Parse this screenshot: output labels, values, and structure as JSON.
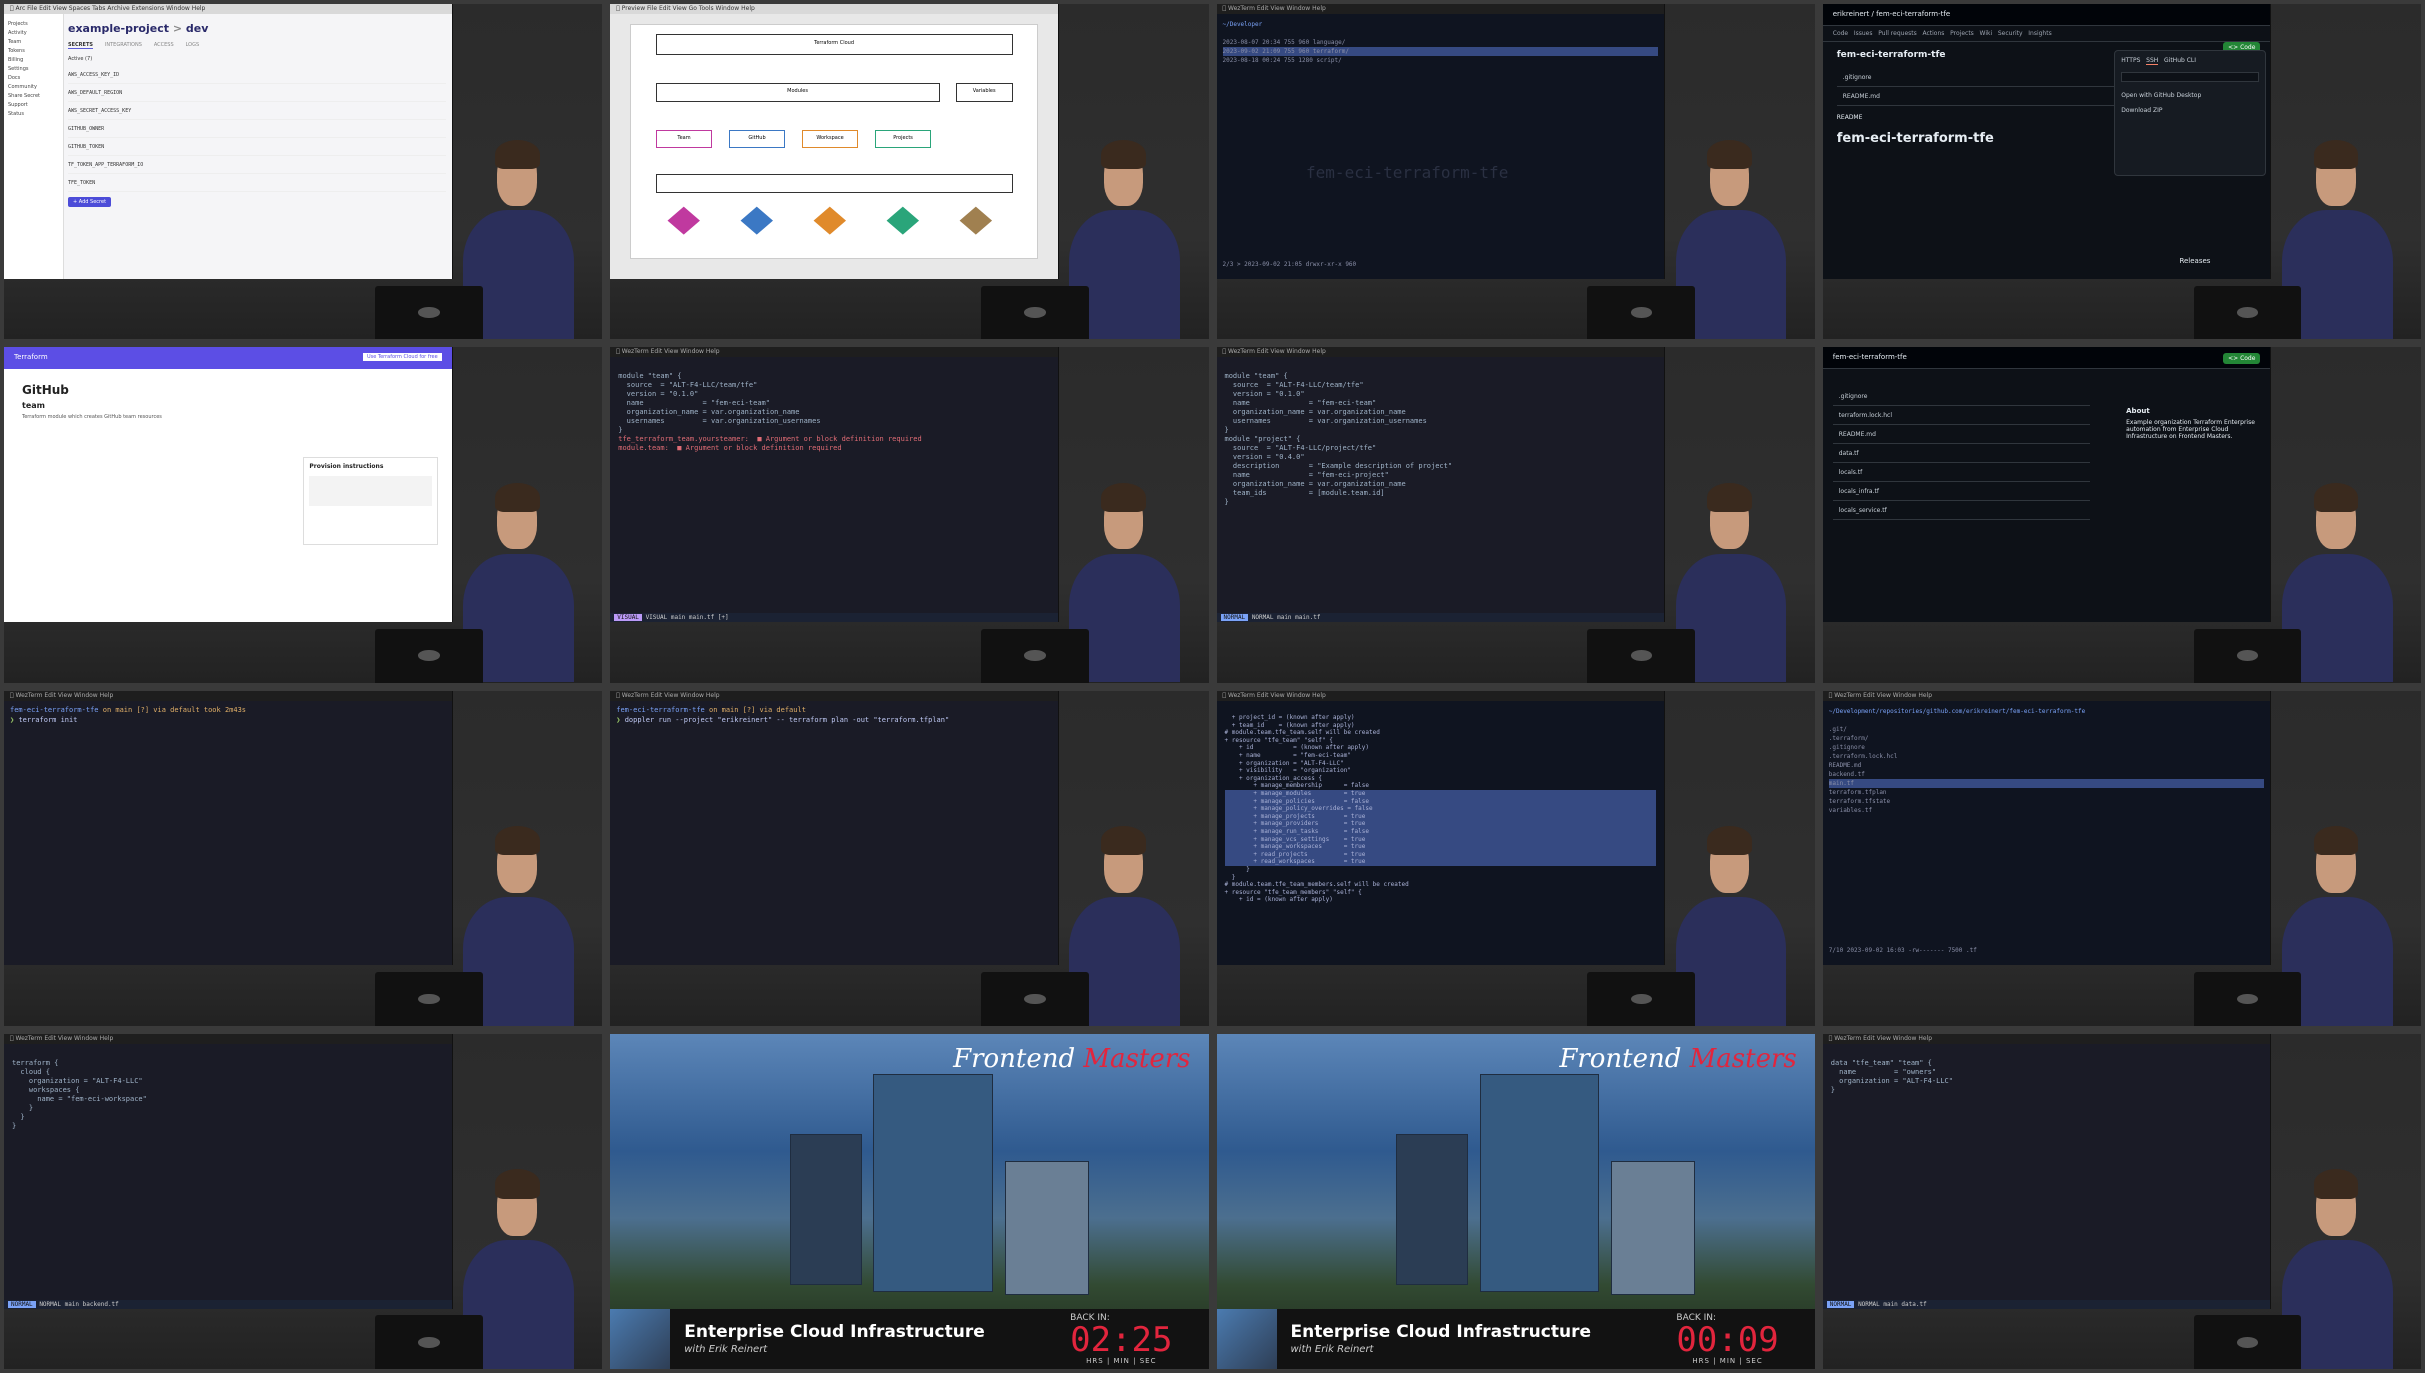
{
  "tiles": {
    "t1": {
      "project": "example-project",
      "env": "dev",
      "tabs": [
        "SECRETS",
        "INTEGRATIONS",
        "ACCESS",
        "LOGS"
      ],
      "active_label": "Active (7)",
      "secrets": [
        "AWS_ACCESS_KEY_ID",
        "AWS_DEFAULT_REGION",
        "AWS_SECRET_ACCESS_KEY",
        "GITHUB_OWNER",
        "GITHUB_TOKEN",
        "TF_TOKEN_APP_TERRAFORM_IO",
        "TFE_TOKEN"
      ],
      "add_secret": "+ Add Secret",
      "sidebar": [
        "Projects",
        "Activity",
        "Team",
        "Tokens",
        "Billing",
        "Settings",
        "Docs",
        "Community",
        "Share Secret",
        "Support",
        "Status"
      ]
    },
    "t2": {
      "nodes": [
        "Terraform Cloud",
        "Modules",
        "Variables",
        "Team",
        "GitHub",
        "Workspace",
        "Projects"
      ]
    },
    "t3": {
      "path": "~/Developer",
      "lines": [
        "2023-08-07 20:34  755   960  language/",
        "2023-09-02 21:09  755   960  terraform/",
        "2023-08-18 00:24  755  1280  script/"
      ],
      "footer": "2/3 > 2023-09-02 21:05 drwxr-xr-x 960",
      "watermark": "fem-eci-terraform-tfe"
    },
    "t4": {
      "repo": "erikreinert / fem-eci-terraform-tfe",
      "repo_name": "fem-eci-terraform-tfe",
      "nav": [
        "Code",
        "Issues",
        "Pull requests",
        "Actions",
        "Projects",
        "Wiki",
        "Security",
        "Insights"
      ],
      "clone_tabs": [
        "HTTPS",
        "SSH",
        "GitHub CLI"
      ],
      "clone_options": [
        "Open with GitHub Desktop",
        "Download ZIP"
      ],
      "files": [
        ".gitignore",
        "README.md"
      ],
      "readme_label": "README",
      "releases": "Releases",
      "code_btn": "<> Code"
    },
    "t5": {
      "brand": "Terraform",
      "org": "team",
      "desc": "Terraform module which creates GitHub team resources",
      "panel_title": "Provision instructions",
      "cta": "Use Terraform Cloud for free"
    },
    "t6": {
      "code": [
        "module \"team\" {",
        "  source  = \"ALT-F4-LLC/team/tfe\"",
        "  version = \"0.1.0\"",
        "",
        "  name              = \"fem-eci-team\"",
        "  organization_name = var.organization_name",
        "  usernames         = var.organization_usernames",
        "}",
        "",
        "tfe_terraform_team.yoursteamer:  ■ Argument or block definition required",
        "module.team:  ■ Argument or block definition required"
      ],
      "status": "VISUAL  main  main.tf [+]"
    },
    "t7": {
      "code": [
        "module \"team\" {",
        "  source  = \"ALT-F4-LLC/team/tfe\"",
        "  version = \"0.1.0\"",
        "",
        "  name              = \"fem-eci-team\"",
        "  organization_name = var.organization_name",
        "  usernames         = var.organization_usernames",
        "}",
        "",
        "module \"project\" {",
        "  source  = \"ALT-F4-LLC/project/tfe\"",
        "  version = \"0.4.0\"",
        "",
        "  description       = \"Example description of project\"",
        "  name              = \"fem-eci-project\"",
        "  organization_name = var.organization_name",
        "  team_ids          = [module.team.id]",
        "}"
      ],
      "status": "NORMAL  main  main.tf"
    },
    "t8": {
      "repo_name": "fem-eci-terraform-tfe",
      "files": [
        ".gitignore",
        "terraform.lock.hcl",
        "README.md",
        "data.tf",
        "locals.tf",
        "locals_infra.tf",
        "locals_service.tf"
      ],
      "about_title": "About",
      "about": "Example organization Terraform Enterprise automation from Enterprise Cloud Infrastructure on Frontend Masters.",
      "code_btn": "<> Code"
    },
    "t9": {
      "prompt_dir": "fem-eci-terraform-tfe",
      "prompt_rest": "on  main [?] via  default took 2m43s",
      "cmd": "terraform init"
    },
    "t10": {
      "prompt_dir": "fem-eci-terraform-tfe",
      "prompt_rest": "on  main [?] via  default",
      "cmd": "doppler run --project \"erikreinert\" -- terraform plan -out \"terraform.tfplan\""
    },
    "t11": {
      "lines": [
        "  + project_id = (known after apply)",
        "  + team_id    = (known after apply)",
        "",
        "# module.team.tfe_team.self will be created",
        "+ resource \"tfe_team\" \"self\" {",
        "    + id           = (known after apply)",
        "    + name         = \"fem-eci-team\"",
        "    + organization = \"ALT-F4-LLC\"",
        "    + visibility   = \"organization\"",
        "",
        "    + organization_access {",
        "        + manage_membership      = false",
        "        + manage_modules         = true",
        "        + manage_policies        = false",
        "        + manage_policy_overrides = false",
        "        + manage_projects        = true",
        "        + manage_providers       = true",
        "        + manage_run_tasks       = false",
        "        + manage_vcs_settings    = true",
        "        + manage_workspaces      = true",
        "        + read_projects          = true",
        "        + read_workspaces        = true",
        "      }",
        "  }",
        "",
        "# module.team.tfe_team_members.self will be created",
        "+ resource \"tfe_team_members\" \"self\" {",
        "    + id = (known after apply)"
      ]
    },
    "t12": {
      "path": "~/Development/repositories/github.com/erikreinert/fem-eci-terraform-tfe",
      "entries": [
        ".git/",
        ".terraform/",
        ".gitignore",
        ".terraform.lock.hcl",
        "README.md",
        "backend.tf",
        "main.tf",
        "terraform.tfplan",
        "terraform.tfstate",
        "variables.tf"
      ],
      "footer": "7/10  2023-09-02 16:03  -rw-------  7500 .tf"
    },
    "t13": {
      "code": [
        "terraform {",
        "  cloud {",
        "    organization = \"ALT-F4-LLC\"",
        "",
        "    workspaces {",
        "      name = \"fem-eci-workspace\"",
        "    }",
        "  }",
        "}"
      ],
      "status": "NORMAL  main  backend.tf"
    },
    "t14": {
      "logo_a": "Frontend",
      "logo_b": "Masters",
      "title": "Enterprise Cloud Infrastructure",
      "subtitle": "with Erik Reinert",
      "back_in": "BACK IN:",
      "time": "02:25",
      "units": "HRS | MIN | SEC"
    },
    "t15": {
      "logo_a": "Frontend",
      "logo_b": "Masters",
      "title": "Enterprise Cloud Infrastructure",
      "subtitle": "with Erik Reinert",
      "back_in": "BACK IN:",
      "time": "00:09",
      "units": "HRS | MIN | SEC"
    },
    "t16": {
      "code": [
        "data \"tfe_team\" \"team\" {",
        "  name         = \"owners\"",
        "  organization = \"ALT-F4-LLC\"",
        "}"
      ],
      "status": "NORMAL  main  data.tf"
    }
  }
}
